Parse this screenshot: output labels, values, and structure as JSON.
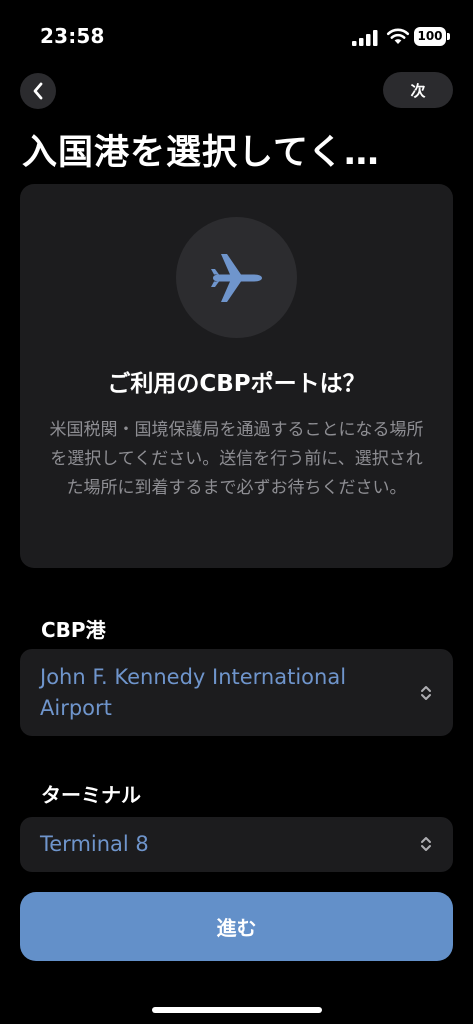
{
  "status_bar": {
    "time": "23:58",
    "battery": "100"
  },
  "nav": {
    "next_label": "次"
  },
  "page_title": "入国港を選択してく…",
  "info_card": {
    "icon": "airplane-icon",
    "title": "ご利用のCBPポートは？",
    "description": "米国税関・国境保護局を通過することになる場所を選択してください。送信を行う前に、選択された場所に到着するまで必ずお待ちください。"
  },
  "port": {
    "label": "CBP港",
    "value": "John F. Kennedy International Airport"
  },
  "terminal": {
    "label": "ターミナル",
    "value": "Terminal 8"
  },
  "proceed_label": "進む",
  "colors": {
    "accent": "#6390c9",
    "value_text": "#6f95cc",
    "card_bg": "#1c1c1e",
    "background": "#000000"
  }
}
